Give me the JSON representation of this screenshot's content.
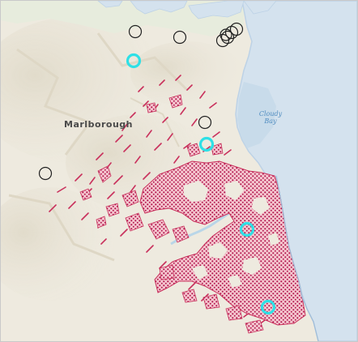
{
  "map": {
    "labels": {
      "region": "Marlborough",
      "bay_line1": "Cloudy",
      "bay_line2": "Bay"
    },
    "colors": {
      "land": "#eeeadf",
      "land_shade": "#e3ddcd",
      "hill_shade": "#d9d3c2",
      "north_land": "#e7ecdd",
      "sea": "#d4e2ee",
      "sea_edge": "#bdd2e6",
      "shallow": "#c8dbea",
      "river": "#b9d6e8",
      "vegetation_fill": "#f4c5ce",
      "vegetation_dots": "#b0124a",
      "vegetation_edge": "#c9305c",
      "marker_default": "#222222",
      "marker_highlight": "#2ee0e6",
      "label_text": "#4a4a4a",
      "water_label": "#4f8cc0"
    },
    "markers": {
      "default": [
        {
          "name": "marker-north-1"
        },
        {
          "name": "marker-north-2"
        },
        {
          "name": "marker-cluster-1"
        },
        {
          "name": "marker-cluster-2"
        },
        {
          "name": "marker-cluster-3"
        },
        {
          "name": "marker-cluster-4"
        },
        {
          "name": "marker-cluster-5"
        },
        {
          "name": "marker-central"
        },
        {
          "name": "marker-west"
        }
      ],
      "highlighted": [
        {
          "name": "highlight-north"
        },
        {
          "name": "highlight-central"
        },
        {
          "name": "highlight-east"
        },
        {
          "name": "highlight-south"
        }
      ]
    }
  }
}
